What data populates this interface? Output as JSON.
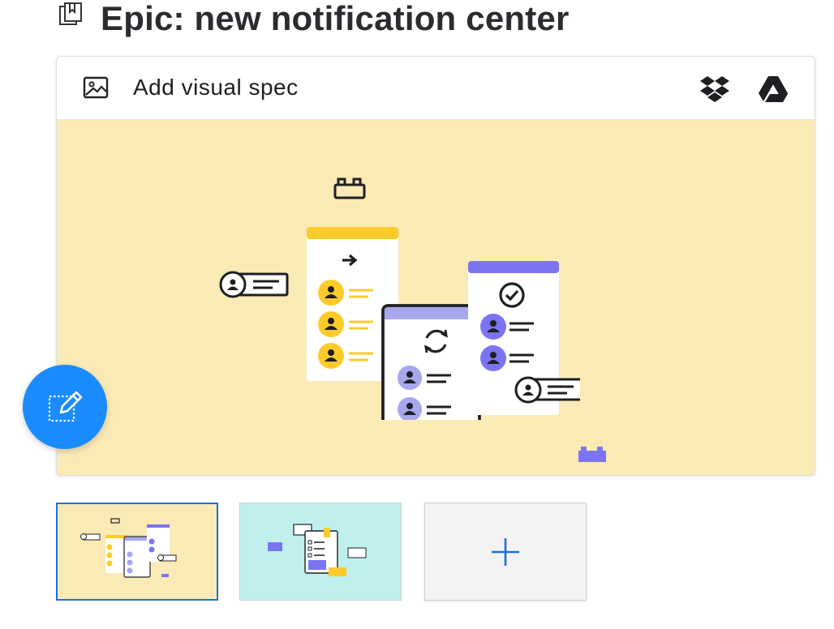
{
  "epic": {
    "title": "Epic: new notification center",
    "icon": "bookmark-pages-icon"
  },
  "visual_spec": {
    "add_label": "Add visual spec",
    "add_icon": "image-icon",
    "integrations": [
      "dropbox-icon",
      "google-drive-icon"
    ],
    "background": "#faeab6"
  },
  "fab": {
    "icon": "edit-selection-icon",
    "color": "#1a8cff"
  },
  "thumbnails": [
    {
      "name": "thumbnail-1",
      "selected": true,
      "background": "#faeab6"
    },
    {
      "name": "thumbnail-2",
      "selected": false,
      "background": "#bff0ee"
    }
  ],
  "add_thumbnail": {
    "icon": "plus-icon"
  },
  "colors": {
    "accent": "#1a8cff",
    "selected_border": "#1f6fd6",
    "yellow": "#fccb2a",
    "purple": "#7b74f0",
    "lavender": "#a7a7ee"
  }
}
